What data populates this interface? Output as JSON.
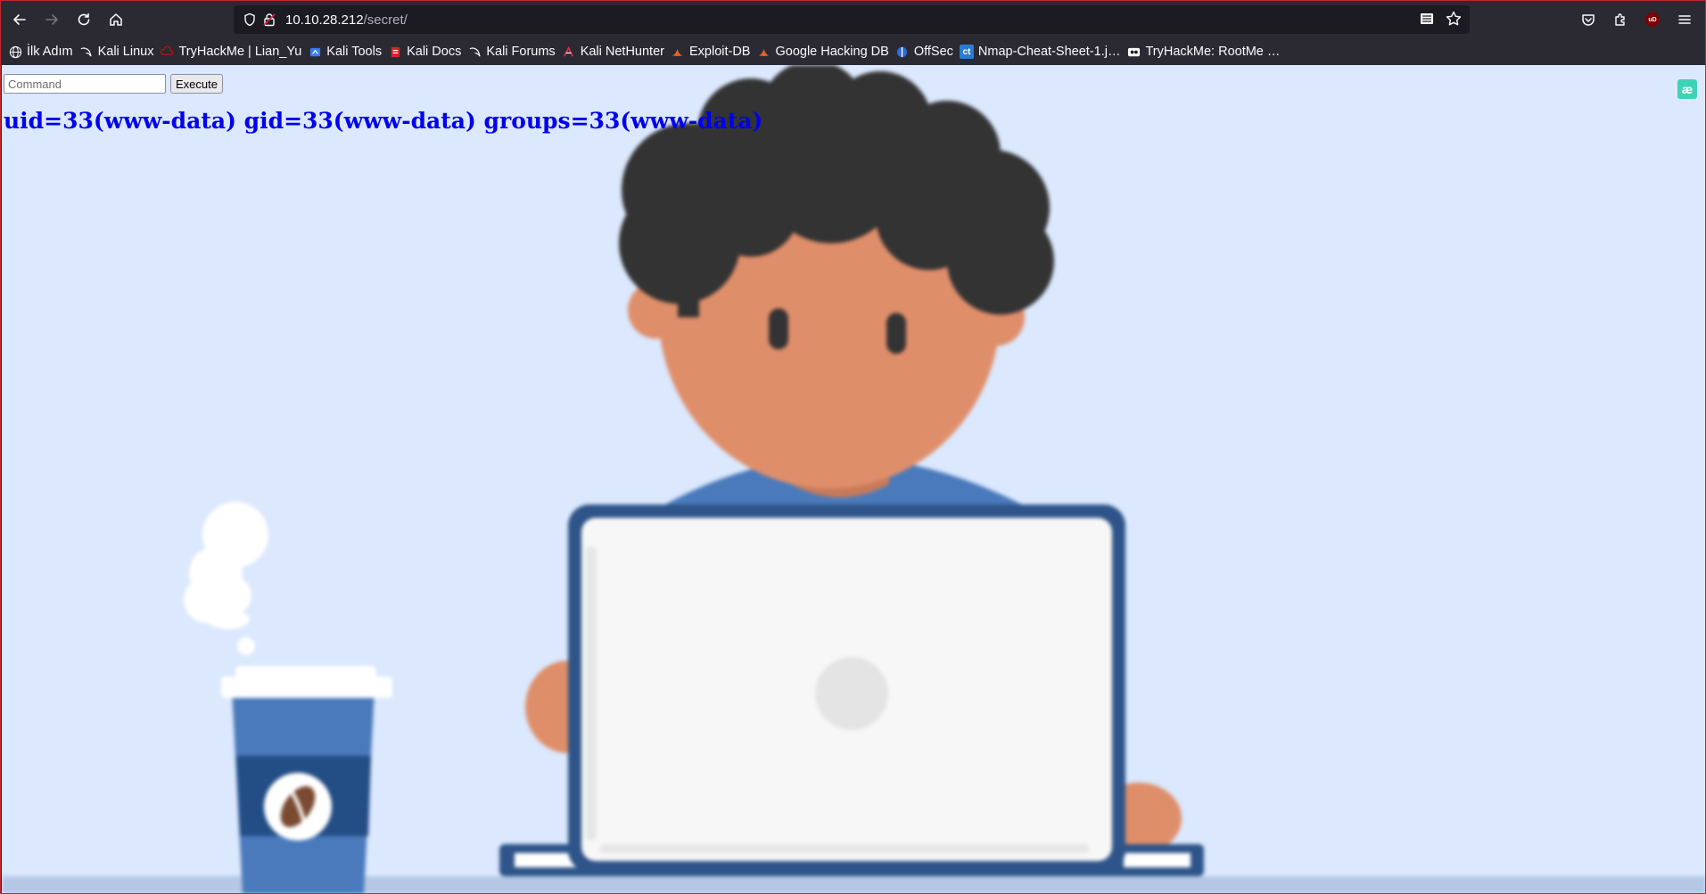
{
  "browser": {
    "url_host": "10.10.28.212",
    "url_path": "/secret/",
    "bookmarks": [
      {
        "label": "İlk Adım",
        "icon": "globe-icon"
      },
      {
        "label": "Kali Linux",
        "icon": "kali-dragon-icon"
      },
      {
        "label": "TryHackMe | Lian_Yu",
        "icon": "tryhackme-icon"
      },
      {
        "label": "Kali Tools",
        "icon": "kali-tools-icon"
      },
      {
        "label": "Kali Docs",
        "icon": "kali-docs-icon"
      },
      {
        "label": "Kali Forums",
        "icon": "kali-dragon-icon"
      },
      {
        "label": "Kali NetHunter",
        "icon": "nethunter-icon"
      },
      {
        "label": "Exploit-DB",
        "icon": "exploit-db-icon"
      },
      {
        "label": "Google Hacking DB",
        "icon": "exploit-db-icon"
      },
      {
        "label": "OffSec",
        "icon": "offsec-icon"
      },
      {
        "label": "Nmap-Cheat-Sheet-1.j…",
        "icon": "ct-icon"
      },
      {
        "label": "TryHackMe: RootMe …",
        "icon": "tryhackme-icon"
      }
    ],
    "ublock_badge": "uD",
    "extension_badge": "æ"
  },
  "page": {
    "command_placeholder": "Command",
    "execute_label": "Execute",
    "output": "uid=33(www-data) gid=33(www-data) groups=33(www-data)"
  },
  "colors": {
    "page_background": "#dbe8fd",
    "output_text": "#0000ee",
    "frame_border": "#c0282d"
  }
}
